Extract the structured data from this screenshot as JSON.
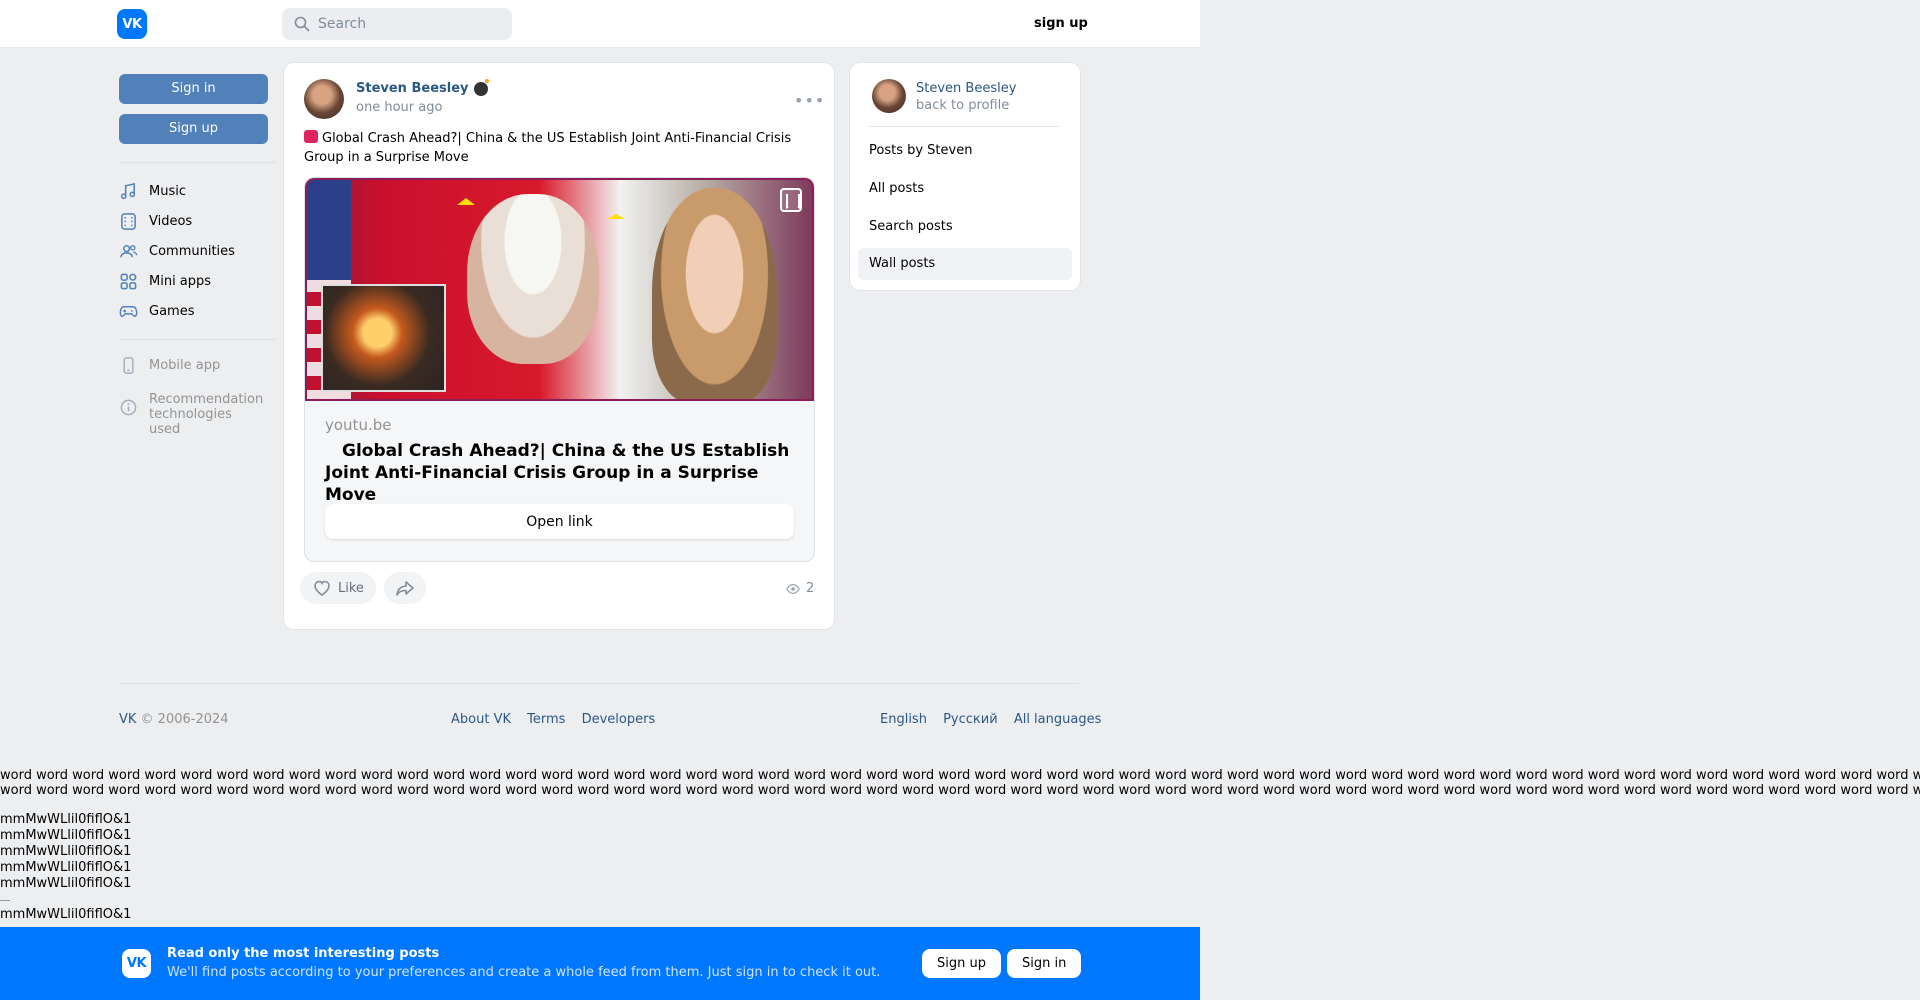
{
  "header": {
    "logo_text": "VK",
    "search_placeholder": "Search",
    "signup_label": "sign up"
  },
  "left_nav": {
    "signin_label": "Sign in",
    "signup_label": "Sign up",
    "items": [
      {
        "label": "Music",
        "icon": "music-icon"
      },
      {
        "label": "Videos",
        "icon": "video-icon"
      },
      {
        "label": "Communities",
        "icon": "communities-icon"
      },
      {
        "label": "Mini apps",
        "icon": "mini-apps-icon"
      },
      {
        "label": "Games",
        "icon": "games-icon"
      }
    ],
    "mobile_app": "Mobile app",
    "recommendation_line1": "Recommendation",
    "recommendation_line2": "technologies used"
  },
  "post": {
    "author": "Steven Beesley",
    "time": "one hour ago",
    "text": "Global Crash Ahead?| China & the US Establish Joint Anti-Financial Crisis Group in a Surprise Move",
    "attachment": {
      "domain": "youtu.be",
      "title": " Global Crash Ahead?| China & the US Establish Joint Anti-Financial Crisis Group in a Surprise Move",
      "open_link_label": "Open link"
    },
    "like_label": "Like",
    "views": "2"
  },
  "right_panel": {
    "name": "Steven Beesley",
    "back": "back to profile",
    "items": [
      "Posts by Steven",
      "All posts",
      "Search posts",
      "Wall posts"
    ],
    "active_item": "Wall posts"
  },
  "footer": {
    "vk": "VK",
    "copyright": " © 2006-2024",
    "about": "About VK",
    "terms": "Terms",
    "developers": "Developers",
    "lang_en": "English",
    "lang_ru": "Русский",
    "lang_all": "All languages"
  },
  "raw_text": {
    "word_line": "word word word word word word word word word word word word word word word word word word word word word word word word word word word word word word word word word word word word word word word word word word word word word word word word word word word word word word word word word word",
    "glyph_line": "mmMwWLlil0fiflO&1"
  },
  "banner": {
    "title": "Read only the most interesting posts",
    "subtitle": "We'll find posts according to your preferences and create a whole feed from them. Just sign in to check it out.",
    "signup_label": "Sign up",
    "signin_label": "Sign in"
  },
  "colors": {
    "accent": "#0077ff",
    "button_blue": "#5181b8",
    "link": "#2a5885",
    "background": "#edeef0"
  }
}
